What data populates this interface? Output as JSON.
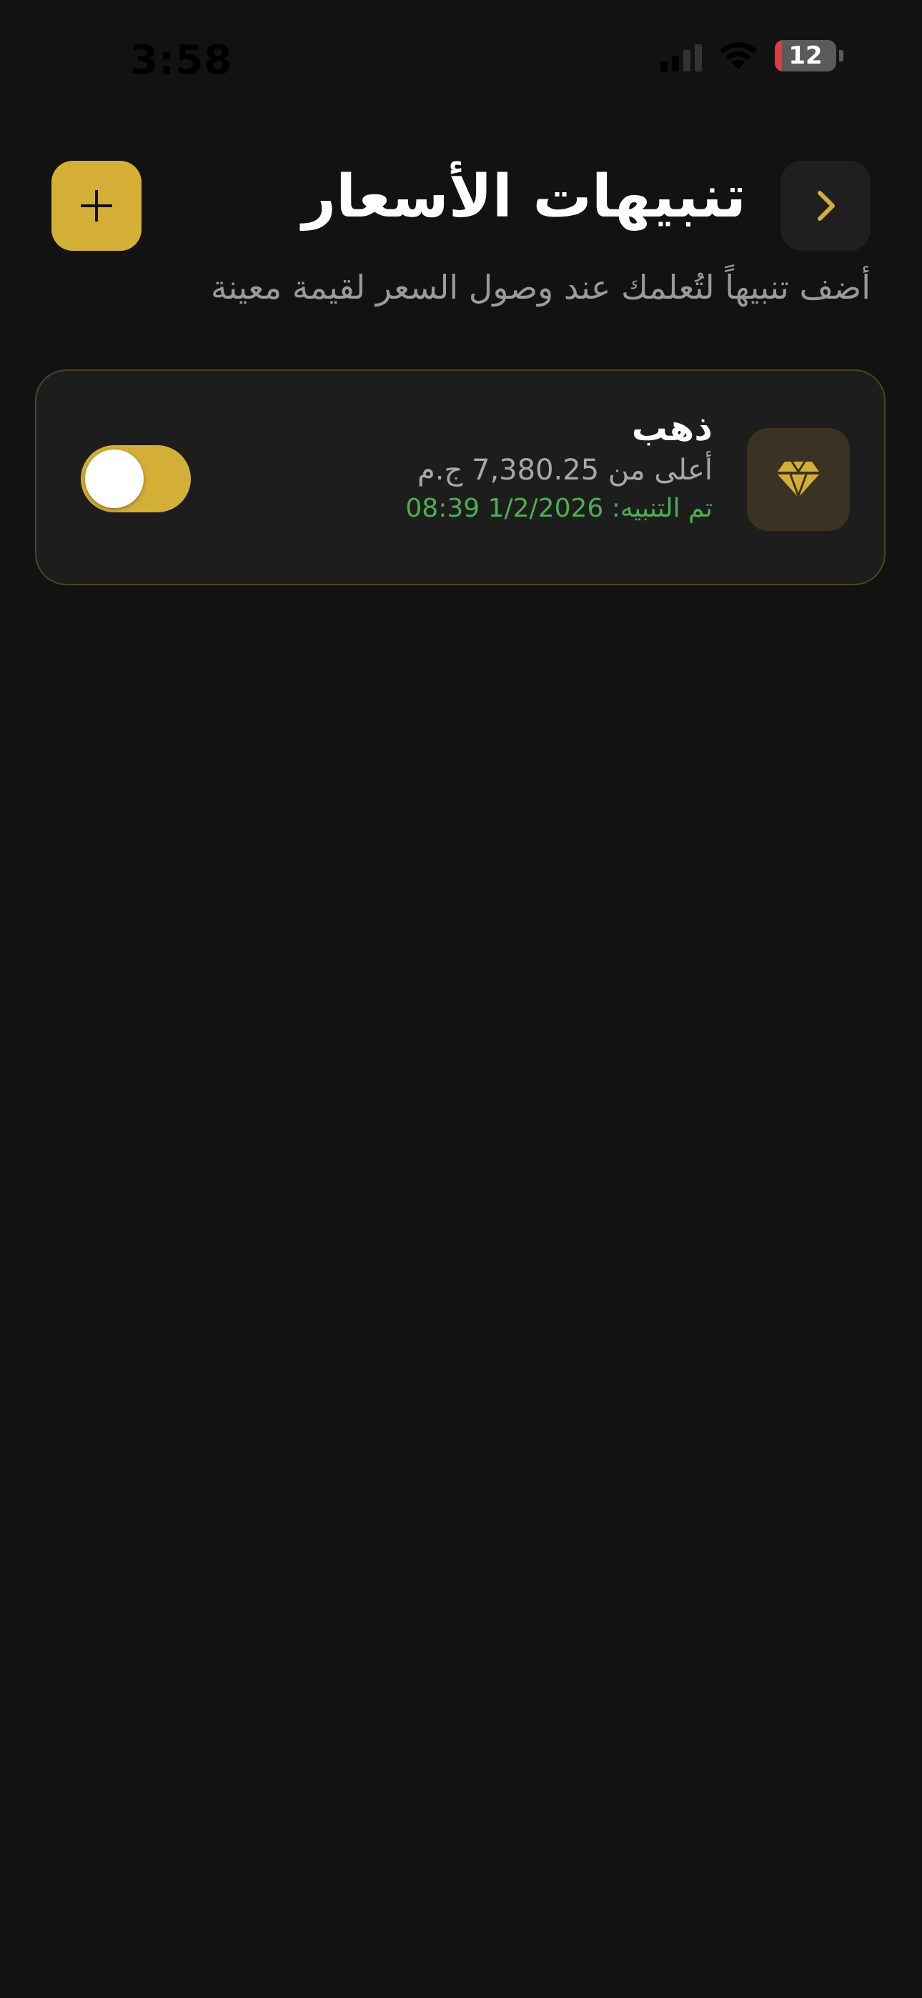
{
  "status_bar": {
    "time": "3:58",
    "battery_percent": "12"
  },
  "header": {
    "title": "تنبيهات الأسعار",
    "subtitle": "أضف تنبيهاً لتُعلمك عند وصول السعر لقيمة معينة",
    "add_icon": "plus-icon",
    "back_icon": "chevron-right-icon"
  },
  "alerts": [
    {
      "name": "ذهب",
      "condition": "أعلى من 7,380.25 ج.م",
      "triggered": "تم التنبيه: 1/2/2026 08:39",
      "icon": "diamond-icon",
      "enabled": true
    }
  ],
  "colors": {
    "background": "#121212",
    "accent_gold": "#d4af37",
    "triggered_green": "#4caf50",
    "card_background": "#1d1d1d",
    "battery_low": "#e5393f"
  }
}
